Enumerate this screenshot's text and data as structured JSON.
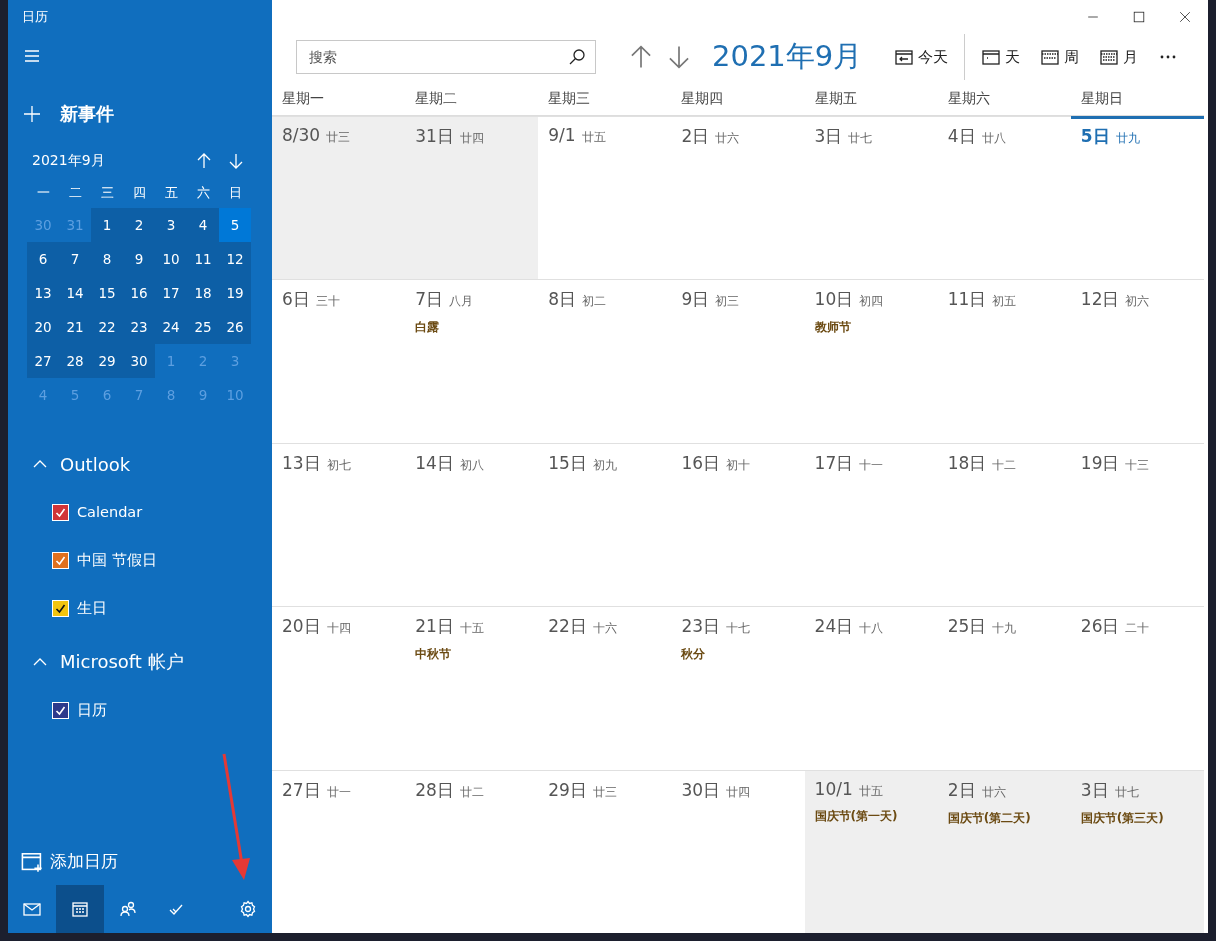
{
  "window": {
    "title": "日历"
  },
  "sidebar": {
    "new_event": "新事件",
    "mini_calendar": {
      "title": "2021年9月",
      "weekdays": [
        "一",
        "二",
        "三",
        "四",
        "五",
        "六",
        "日"
      ],
      "weeks": [
        [
          {
            "day": "30",
            "in_month": false,
            "selected": false
          },
          {
            "day": "31",
            "in_month": false,
            "selected": false
          },
          {
            "day": "1",
            "in_month": true,
            "selected": false
          },
          {
            "day": "2",
            "in_month": true,
            "selected": false
          },
          {
            "day": "3",
            "in_month": true,
            "selected": false
          },
          {
            "day": "4",
            "in_month": true,
            "selected": false
          },
          {
            "day": "5",
            "in_month": true,
            "selected": true
          }
        ],
        [
          {
            "day": "6",
            "in_month": true,
            "selected": false
          },
          {
            "day": "7",
            "in_month": true,
            "selected": false
          },
          {
            "day": "8",
            "in_month": true,
            "selected": false
          },
          {
            "day": "9",
            "in_month": true,
            "selected": false
          },
          {
            "day": "10",
            "in_month": true,
            "selected": false
          },
          {
            "day": "11",
            "in_month": true,
            "selected": false
          },
          {
            "day": "12",
            "in_month": true,
            "selected": false
          }
        ],
        [
          {
            "day": "13",
            "in_month": true,
            "selected": false
          },
          {
            "day": "14",
            "in_month": true,
            "selected": false
          },
          {
            "day": "15",
            "in_month": true,
            "selected": false
          },
          {
            "day": "16",
            "in_month": true,
            "selected": false
          },
          {
            "day": "17",
            "in_month": true,
            "selected": false
          },
          {
            "day": "18",
            "in_month": true,
            "selected": false
          },
          {
            "day": "19",
            "in_month": true,
            "selected": false
          }
        ],
        [
          {
            "day": "20",
            "in_month": true,
            "selected": false
          },
          {
            "day": "21",
            "in_month": true,
            "selected": false
          },
          {
            "day": "22",
            "in_month": true,
            "selected": false
          },
          {
            "day": "23",
            "in_month": true,
            "selected": false
          },
          {
            "day": "24",
            "in_month": true,
            "selected": false
          },
          {
            "day": "25",
            "in_month": true,
            "selected": false
          },
          {
            "day": "26",
            "in_month": true,
            "selected": false
          }
        ],
        [
          {
            "day": "27",
            "in_month": true,
            "selected": false
          },
          {
            "day": "28",
            "in_month": true,
            "selected": false
          },
          {
            "day": "29",
            "in_month": true,
            "selected": false
          },
          {
            "day": "30",
            "in_month": true,
            "selected": false
          },
          {
            "day": "1",
            "in_month": false,
            "selected": false
          },
          {
            "day": "2",
            "in_month": false,
            "selected": false
          },
          {
            "day": "3",
            "in_month": false,
            "selected": false
          }
        ],
        [
          {
            "day": "4",
            "in_month": false,
            "selected": false
          },
          {
            "day": "5",
            "in_month": false,
            "selected": false
          },
          {
            "day": "6",
            "in_month": false,
            "selected": false
          },
          {
            "day": "7",
            "in_month": false,
            "selected": false
          },
          {
            "day": "8",
            "in_month": false,
            "selected": false
          },
          {
            "day": "9",
            "in_month": false,
            "selected": false
          },
          {
            "day": "10",
            "in_month": false,
            "selected": false
          }
        ]
      ]
    },
    "groups": [
      {
        "name": "Outlook",
        "expanded": true,
        "calendars": [
          {
            "name": "Calendar",
            "checked": true,
            "color": "#d13438"
          },
          {
            "name": "中国 节假日",
            "checked": true,
            "color": "#e0701e"
          },
          {
            "name": "生日",
            "checked": true,
            "color": "#f2c40f"
          }
        ]
      },
      {
        "name": "Microsoft 帐户",
        "expanded": true,
        "calendars": [
          {
            "name": "日历",
            "checked": true,
            "color": "#2d3a8c"
          }
        ]
      }
    ],
    "add_calendar": "添加日历",
    "nav": [
      {
        "kind": "mail",
        "selected": false
      },
      {
        "kind": "calendar",
        "selected": true
      },
      {
        "kind": "people",
        "selected": false
      },
      {
        "kind": "todo",
        "selected": false
      },
      {
        "kind": "settings",
        "selected": false
      }
    ]
  },
  "search": {
    "placeholder": "搜索"
  },
  "month_title": "2021年9月",
  "views": [
    {
      "kind": "today",
      "label": "今天"
    },
    {
      "kind": "day",
      "label": "天"
    },
    {
      "kind": "week",
      "label": "周"
    },
    {
      "kind": "month",
      "label": "月"
    }
  ],
  "weekdays": [
    "星期一",
    "星期二",
    "星期三",
    "星期四",
    "星期五",
    "星期六",
    "星期日"
  ],
  "weeks": [
    [
      {
        "date": "8/30",
        "lunar": "廿三",
        "in_month": false,
        "today": false
      },
      {
        "date": "31日",
        "lunar": "廿四",
        "in_month": false,
        "today": false
      },
      {
        "date": "9/1",
        "lunar": "廿五",
        "in_month": true,
        "today": false
      },
      {
        "date": "2日",
        "lunar": "廿六",
        "in_month": true,
        "today": false
      },
      {
        "date": "3日",
        "lunar": "廿七",
        "in_month": true,
        "today": false
      },
      {
        "date": "4日",
        "lunar": "廿八",
        "in_month": true,
        "today": false
      },
      {
        "date": "5日",
        "lunar": "廿九",
        "in_month": true,
        "today": true
      }
    ],
    [
      {
        "date": "6日",
        "lunar": "三十",
        "in_month": true,
        "today": false
      },
      {
        "date": "7日",
        "lunar": "八月",
        "in_month": true,
        "today": false,
        "events": [
          "白露"
        ]
      },
      {
        "date": "8日",
        "lunar": "初二",
        "in_month": true,
        "today": false
      },
      {
        "date": "9日",
        "lunar": "初三",
        "in_month": true,
        "today": false
      },
      {
        "date": "10日",
        "lunar": "初四",
        "in_month": true,
        "today": false,
        "events": [
          "教师节"
        ]
      },
      {
        "date": "11日",
        "lunar": "初五",
        "in_month": true,
        "today": false
      },
      {
        "date": "12日",
        "lunar": "初六",
        "in_month": true,
        "today": false
      }
    ],
    [
      {
        "date": "13日",
        "lunar": "初七",
        "in_month": true,
        "today": false
      },
      {
        "date": "14日",
        "lunar": "初八",
        "in_month": true,
        "today": false
      },
      {
        "date": "15日",
        "lunar": "初九",
        "in_month": true,
        "today": false
      },
      {
        "date": "16日",
        "lunar": "初十",
        "in_month": true,
        "today": false
      },
      {
        "date": "17日",
        "lunar": "十一",
        "in_month": true,
        "today": false
      },
      {
        "date": "18日",
        "lunar": "十二",
        "in_month": true,
        "today": false
      },
      {
        "date": "19日",
        "lunar": "十三",
        "in_month": true,
        "today": false
      }
    ],
    [
      {
        "date": "20日",
        "lunar": "十四",
        "in_month": true,
        "today": false
      },
      {
        "date": "21日",
        "lunar": "十五",
        "in_month": true,
        "today": false,
        "events": [
          "中秋节"
        ]
      },
      {
        "date": "22日",
        "lunar": "十六",
        "in_month": true,
        "today": false
      },
      {
        "date": "23日",
        "lunar": "十七",
        "in_month": true,
        "today": false,
        "events": [
          "秋分"
        ]
      },
      {
        "date": "24日",
        "lunar": "十八",
        "in_month": true,
        "today": false
      },
      {
        "date": "25日",
        "lunar": "十九",
        "in_month": true,
        "today": false
      },
      {
        "date": "26日",
        "lunar": "二十",
        "in_month": true,
        "today": false
      }
    ],
    [
      {
        "date": "27日",
        "lunar": "廿一",
        "in_month": true,
        "today": false
      },
      {
        "date": "28日",
        "lunar": "廿二",
        "in_month": true,
        "today": false
      },
      {
        "date": "29日",
        "lunar": "廿三",
        "in_month": true,
        "today": false
      },
      {
        "date": "30日",
        "lunar": "廿四",
        "in_month": true,
        "today": false
      },
      {
        "date": "10/1",
        "lunar": "廿五",
        "in_month": false,
        "today": false,
        "events": [
          "国庆节(第一天)"
        ]
      },
      {
        "date": "2日",
        "lunar": "廿六",
        "in_month": false,
        "today": false,
        "events": [
          "国庆节(第二天)"
        ]
      },
      {
        "date": "3日",
        "lunar": "廿七",
        "in_month": false,
        "today": false,
        "events": [
          "国庆节(第三天)"
        ]
      }
    ]
  ]
}
